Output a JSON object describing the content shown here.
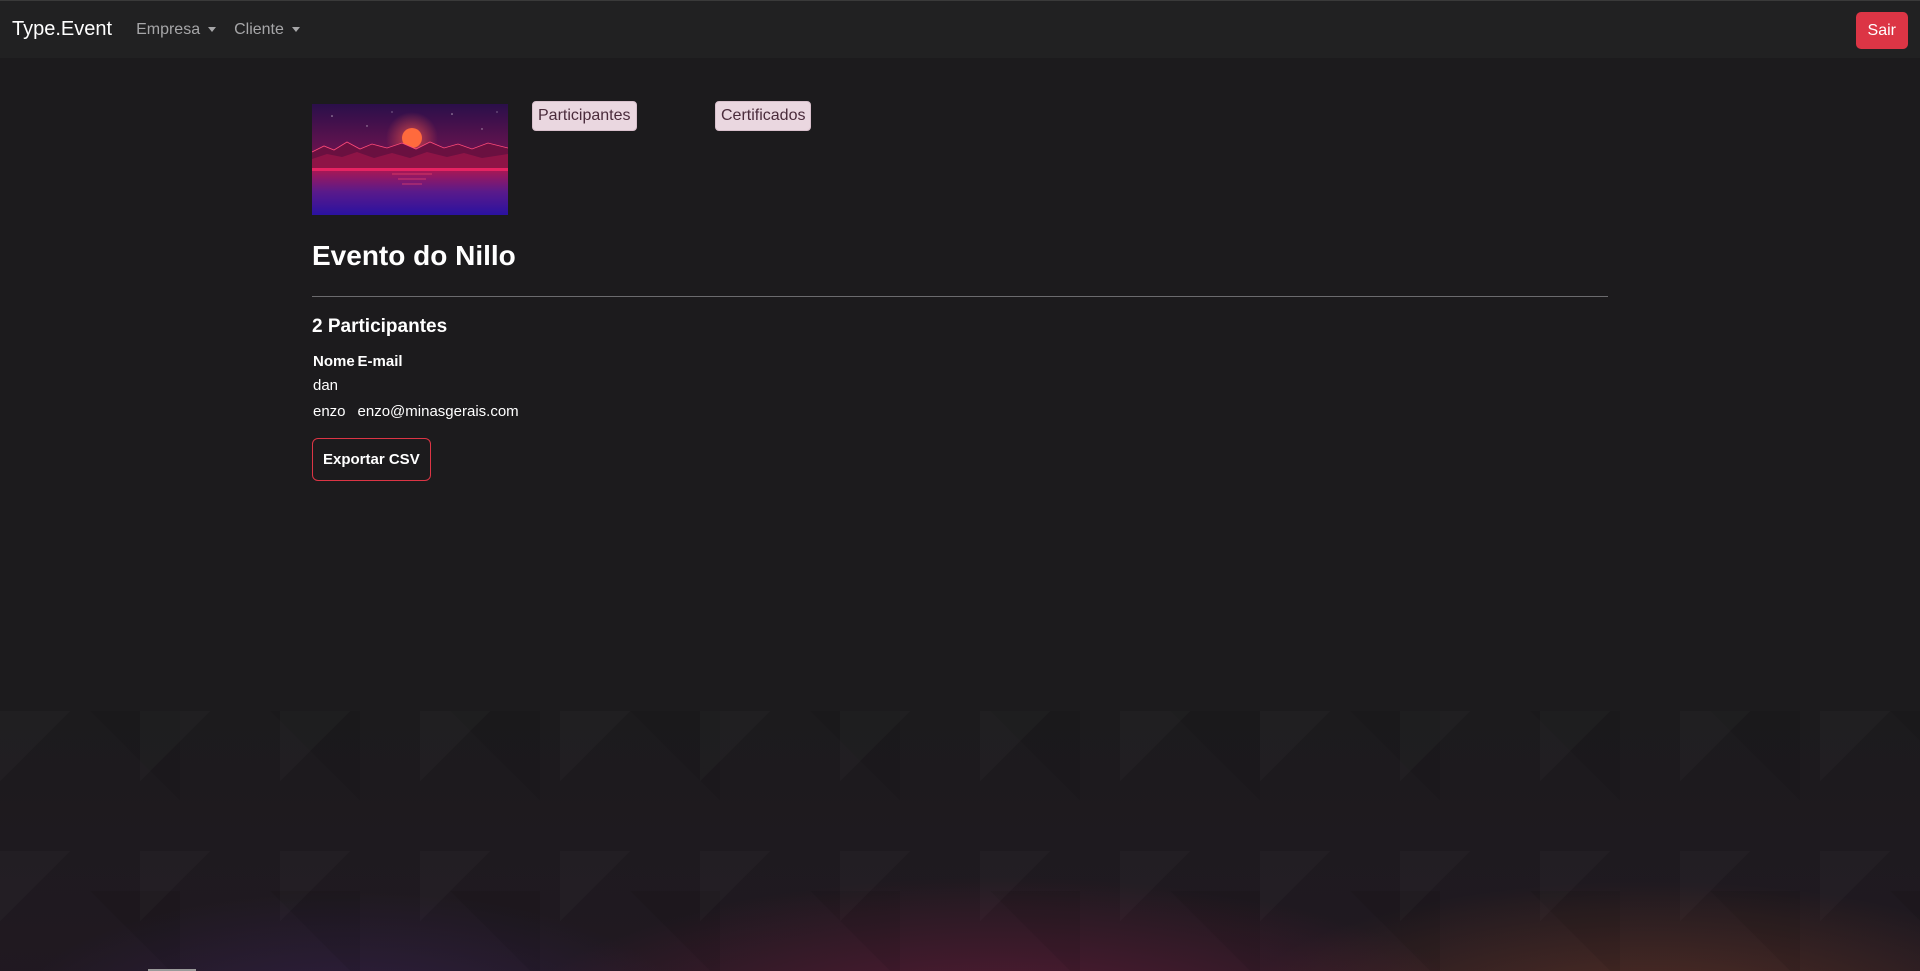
{
  "navbar": {
    "brand": "Type.Event",
    "menus": [
      {
        "label": "Empresa"
      },
      {
        "label": "Cliente"
      }
    ],
    "logout_label": "Sair"
  },
  "event": {
    "tabs": {
      "participants": "Participantes",
      "certificates": "Certificados"
    },
    "title": "Evento do Nillo",
    "participants_heading": "2 Participantes",
    "table": {
      "headers": [
        "Nome",
        "E-mail"
      ],
      "rows": [
        {
          "name": "dan",
          "email": ""
        },
        {
          "name": "enzo",
          "email": "enzo@minasgerais.com"
        }
      ]
    },
    "export_label": "Exportar CSV"
  }
}
